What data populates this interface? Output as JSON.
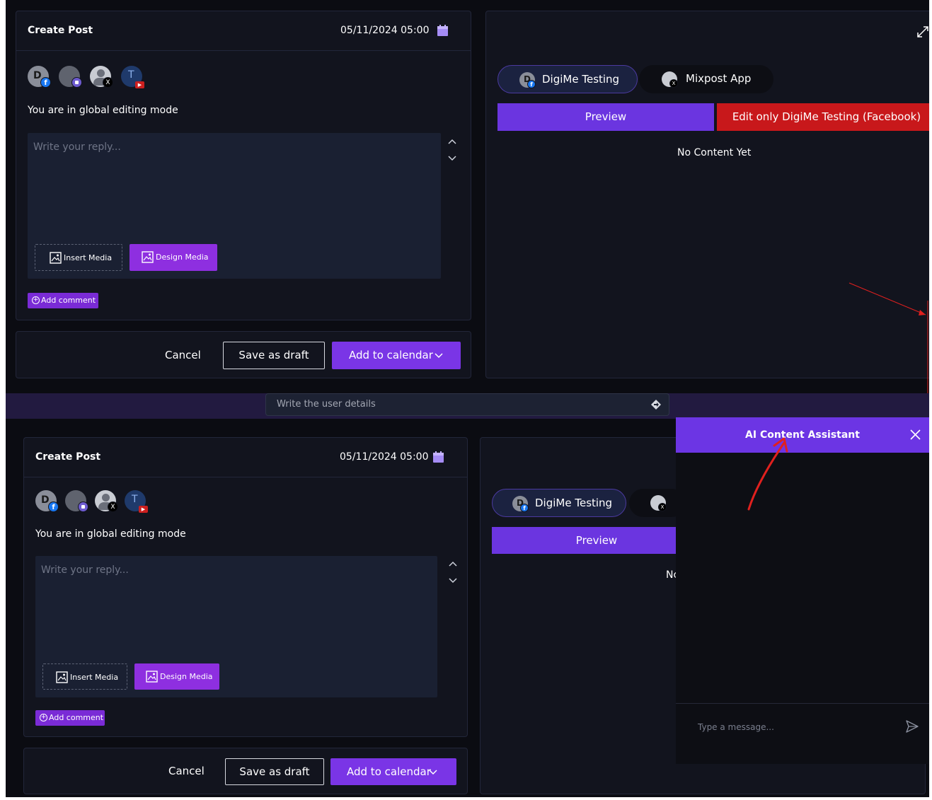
{
  "top": {
    "create_post": {
      "title": "Create Post",
      "datetime": "05/11/2024 05:00",
      "avatars": [
        {
          "letter": "D",
          "network": "facebook"
        },
        {
          "letter": "",
          "network": "mastodon"
        },
        {
          "letter": "",
          "network": "x"
        },
        {
          "letter": "T",
          "network": "youtube"
        }
      ],
      "mode_text": "You are in global editing mode",
      "editor_placeholder": "Write your reply...",
      "insert_media": "Insert Media",
      "design_media": "Design Media",
      "add_comment": "Add comment",
      "cancel": "Cancel",
      "save_draft": "Save as draft",
      "add_calendar": "Add to calendar"
    },
    "preview": {
      "tabs": [
        {
          "label": "DigiMe Testing",
          "letter": "D",
          "active": true
        },
        {
          "label": "Mixpost App",
          "letter": "",
          "active": false
        }
      ],
      "preview_button": "Preview",
      "edit_only_button": "Edit only DigiMe Testing (Facebook)",
      "empty_text": "No Content Yet"
    }
  },
  "strip": {
    "input_text": "Write the user details"
  },
  "bottom": {
    "create_post": {
      "title": "Create Post",
      "datetime": "05/11/2024 05:00",
      "mode_text": "You are in global editing mode",
      "editor_placeholder": "Write your reply...",
      "insert_media": "Insert Media",
      "design_media": "Design Media",
      "add_comment": "Add comment",
      "cancel": "Cancel",
      "save_draft": "Save as draft",
      "add_calendar": "Add to calendar"
    },
    "preview": {
      "tab_label": "DigiMe Testing",
      "preview_button": "Preview",
      "empty_text_partial": "Nc"
    },
    "ai_assistant": {
      "title": "AI Content Assistant",
      "input_placeholder": "Type a message..."
    }
  },
  "colors": {
    "accent": "#6c35e4",
    "danger": "#c8181b",
    "background": "#0b0c12",
    "card": "#12141e",
    "annotation": "#e0201e"
  },
  "icons": [
    "calendar-icon",
    "chevron-up-icon",
    "chevron-down-icon",
    "image-icon",
    "plus-circle-icon",
    "expand-icon",
    "close-icon",
    "send-icon",
    "facebook-icon",
    "mastodon-icon",
    "x-icon",
    "youtube-icon",
    "directions-icon"
  ]
}
